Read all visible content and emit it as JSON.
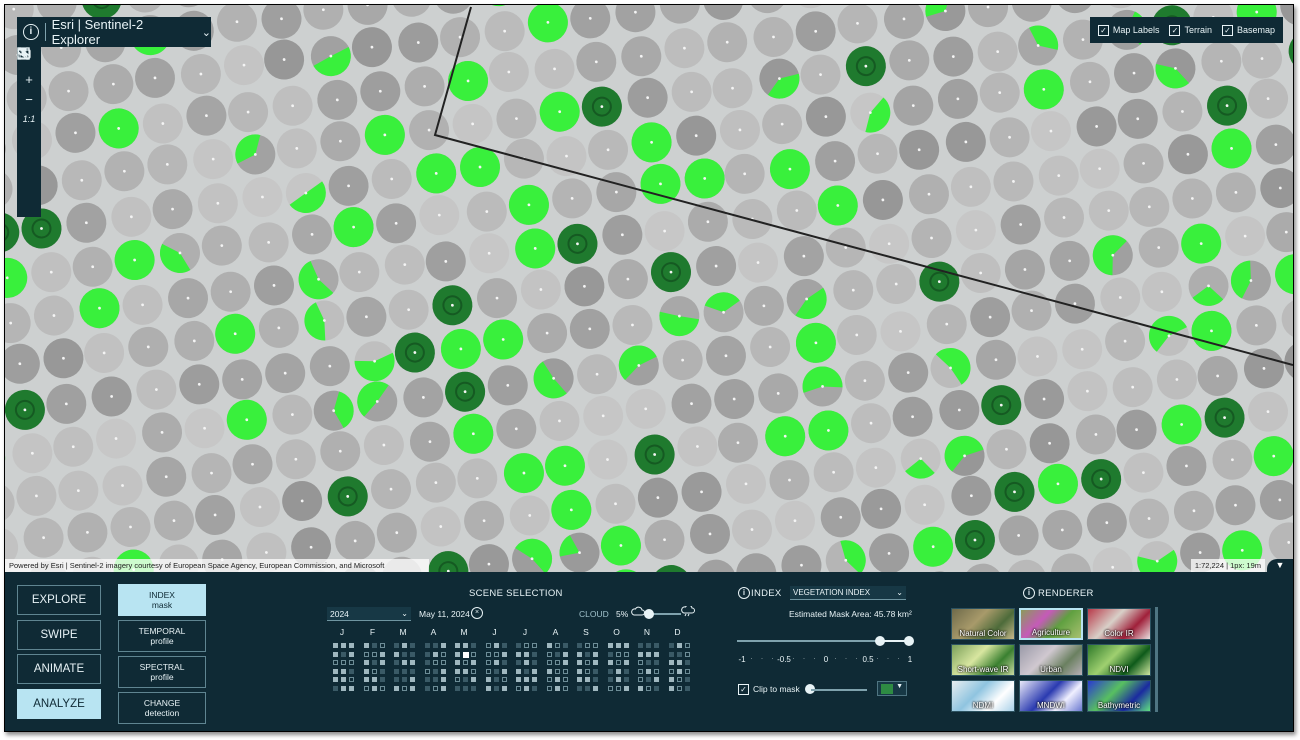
{
  "app": {
    "brand": "Esri | Sentinel-2 Explorer",
    "info_label": "i"
  },
  "toolbar": {
    "search": "search-icon",
    "zoom_in": "+",
    "zoom_out": "−",
    "one_to_one": "1:1",
    "fullscreen": "fullscreen-icon",
    "screenshot": "camera-icon",
    "link": "link-icon",
    "save": "save-icon"
  },
  "layers": {
    "map_labels": "Map Labels",
    "terrain": "Terrain",
    "basemap": "Basemap",
    "map_labels_checked": true,
    "terrain_checked": true,
    "basemap_checked": true
  },
  "attribution": "Powered by Esri | Sentinel-2 imagery courtesy of European Space Agency, European Commission, and Microsoft",
  "scale": "1:72,224 | 1px: 19m",
  "modes": {
    "explore": "EXPLORE",
    "swipe": "SWIPE",
    "animate": "ANIMATE",
    "analyze": "ANALYZE",
    "active": "analyze"
  },
  "tools": {
    "index_title": "INDEX",
    "index_sub": "mask",
    "temporal_title": "TEMPORAL",
    "temporal_sub": "profile",
    "spectral_title": "SPECTRAL",
    "spectral_sub": "profile",
    "change_title": "CHANGE",
    "change_sub": "detection"
  },
  "scene": {
    "title": "SCENE SELECTION",
    "year": "2024",
    "date": "May 11, 2024",
    "cloud_label": "CLOUD",
    "cloud_value": "5%",
    "months": [
      "J",
      "F",
      "M",
      "A",
      "M",
      "J",
      "J",
      "A",
      "S",
      "O",
      "N",
      "D"
    ]
  },
  "index": {
    "title": "INDEX",
    "selected": "VEGETATION INDEX",
    "mask_area": "Estimated Mask Area: 45.78 km²",
    "range_low": 0.65,
    "range_high": 1,
    "ticks": [
      "-1",
      "-0.5",
      "0",
      "0.5",
      "1"
    ],
    "clip_label": "Clip to mask",
    "clip_checked": true,
    "mask_color": "#2e8b43"
  },
  "renderer": {
    "title": "RENDERER",
    "options": [
      "Natural Color",
      "Agriculture",
      "Color IR",
      "Short-wave IR",
      "Urban",
      "NDVI",
      "NDMI",
      "MNDWI",
      "Bathymetric"
    ],
    "active": "Agriculture"
  },
  "colors": {
    "panel": "#0f2a35",
    "accent": "#b8e4f2",
    "veg_bright": "#39f03c",
    "veg_dark": "#1f7a2e"
  }
}
